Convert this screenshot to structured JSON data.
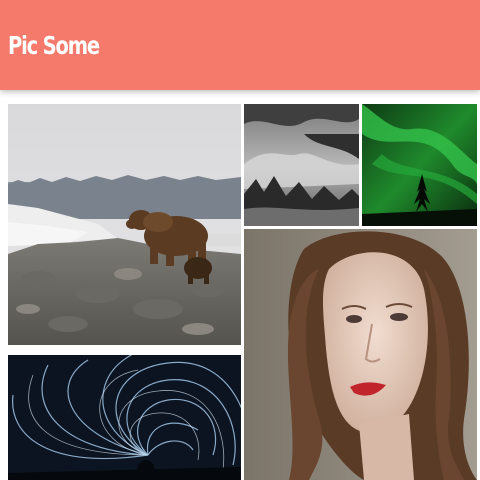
{
  "app": {
    "title": "Pic Some",
    "accent_color": "#f57a6b"
  },
  "gallery": {
    "photos": [
      {
        "name": "photo-bear-and-cub",
        "subject": "bear"
      },
      {
        "name": "photo-misty-forest",
        "subject": "forest"
      },
      {
        "name": "photo-aurora",
        "subject": "aurora"
      },
      {
        "name": "photo-woman-portrait",
        "subject": "portrait"
      },
      {
        "name": "photo-star-trails",
        "subject": "stars"
      }
    ]
  }
}
